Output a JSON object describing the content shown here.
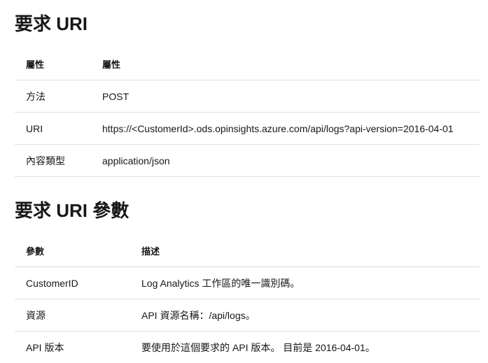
{
  "sections": {
    "request_uri": {
      "heading": "要求 URI",
      "headers": [
        "屬性",
        "屬性"
      ],
      "rows": [
        [
          "方法",
          "POST"
        ],
        [
          "URI",
          "https://<CustomerId>.ods.opinsights.azure.com/api/logs?api-version=2016-04-01"
        ],
        [
          "內容類型",
          "application/json"
        ]
      ]
    },
    "request_uri_params": {
      "heading": "要求 URI 參數",
      "headers": [
        "參數",
        "描述"
      ],
      "rows": [
        [
          "CustomerID",
          "Log Analytics 工作區的唯一識別碼。"
        ],
        [
          "資源",
          "API 資源名稱：/api/logs。"
        ],
        [
          "API 版本",
          "要使用於這個要求的 API 版本。 目前是 2016-04-01。"
        ]
      ]
    }
  }
}
